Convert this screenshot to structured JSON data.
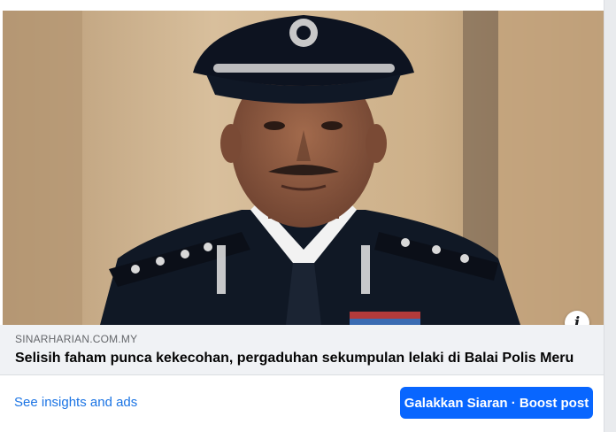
{
  "post": {
    "image_alt": "Police officer in dark uniform and peaked cap",
    "info_icon": "info-icon",
    "link": {
      "domain": "SINARHARIAN.COM.MY",
      "headline": "Selisih faham punca kekecohan, pergaduhan sekumpulan lelaki di Balai Polis Meru"
    },
    "actions": {
      "insights_label": "See insights and ads",
      "boost_label": "Galakkan Siaran · Boost post"
    }
  },
  "colors": {
    "link_blue": "#1b74e4",
    "primary_button": "#0866ff",
    "meta_background": "#f0f2f5"
  }
}
